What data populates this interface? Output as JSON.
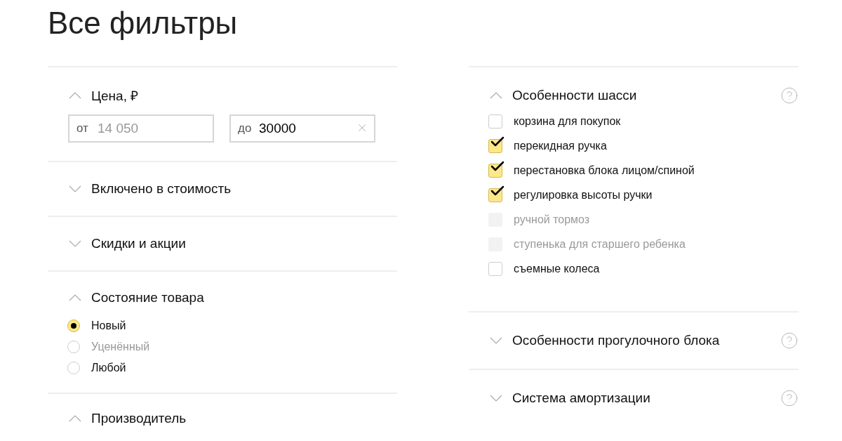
{
  "title": "Все фильтры",
  "left_sections": [
    {
      "kind": "price",
      "title": "Цена, ₽",
      "expanded": true,
      "fields": [
        {
          "prefix": "от",
          "placeholder": "14 050",
          "clearable": false
        },
        {
          "prefix": "до",
          "value": "30000",
          "clearable": true
        }
      ]
    },
    {
      "kind": "plain",
      "title": "Включено в стоимость",
      "expanded": false
    },
    {
      "kind": "plain",
      "title": "Скидки и акции",
      "expanded": false
    },
    {
      "kind": "radio",
      "title": "Состояние товара",
      "expanded": true,
      "options": [
        {
          "label": "Новый",
          "selected": true,
          "disabled": false
        },
        {
          "label": "Уценённый",
          "selected": false,
          "disabled": true
        },
        {
          "label": "Любой",
          "selected": false,
          "disabled": false
        }
      ]
    },
    {
      "kind": "plain",
      "title": "Производитель",
      "expanded": true
    }
  ],
  "right_sections": [
    {
      "kind": "checkbox",
      "title": "Особенности шасси",
      "expanded": true,
      "help": true,
      "options": [
        {
          "label": "корзина для покупок",
          "checked": false,
          "disabled": false
        },
        {
          "label": "перекидная ручка",
          "checked": true,
          "disabled": false
        },
        {
          "label": "перестановка блока лицом/спиной",
          "checked": true,
          "disabled": false
        },
        {
          "label": "регулировка высоты ручки",
          "checked": true,
          "disabled": false
        },
        {
          "label": "ручной тормоз",
          "checked": false,
          "disabled": true
        },
        {
          "label": "ступенька для старшего ребенка",
          "checked": false,
          "disabled": true
        },
        {
          "label": "съемные колеса",
          "checked": false,
          "disabled": false
        }
      ]
    },
    {
      "kind": "plain",
      "title": "Особенности прогулочного блока",
      "expanded": false,
      "help": true
    },
    {
      "kind": "plain",
      "title": "Система амортизации",
      "expanded": false,
      "help": true
    }
  ]
}
